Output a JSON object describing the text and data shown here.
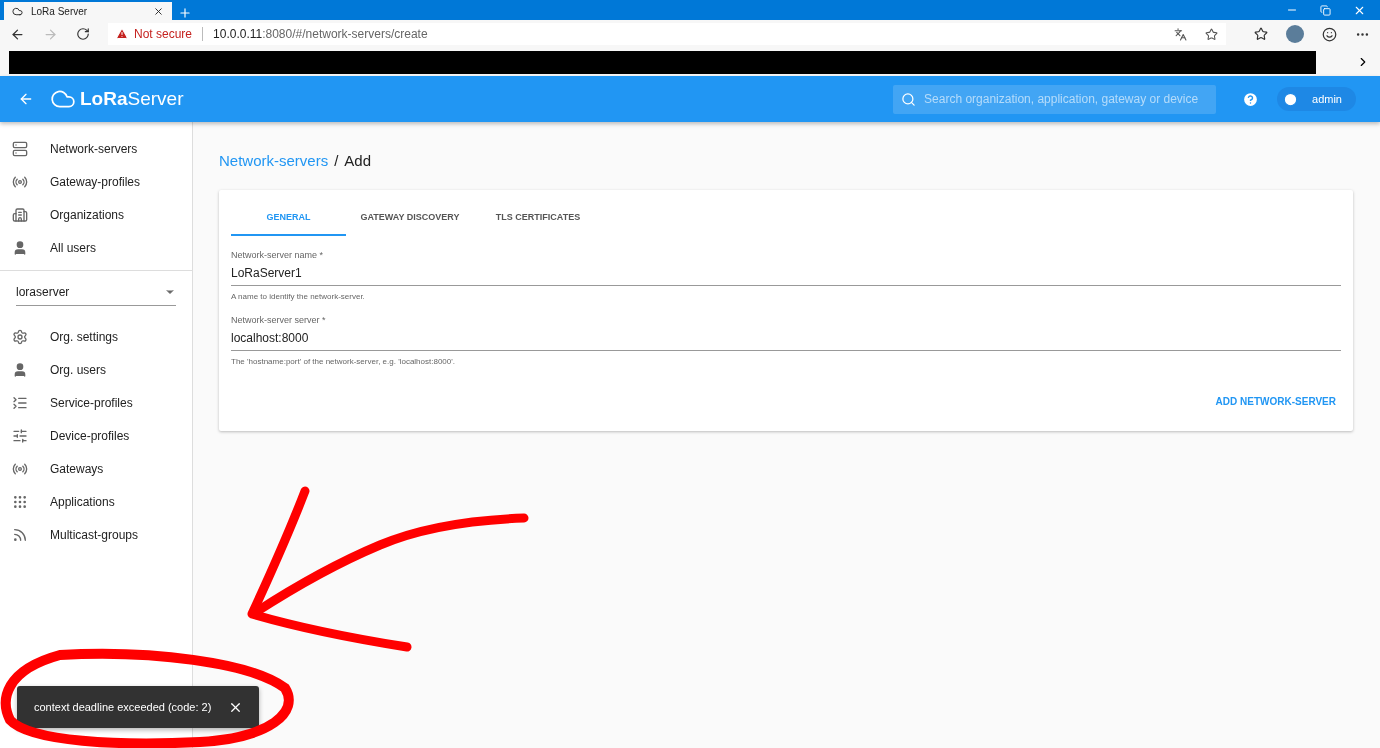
{
  "browser": {
    "tab_title": "LoRa Server",
    "security": "Not secure",
    "host": "10.0.0.11",
    "path": ":8080/#/network-servers/create"
  },
  "app_bar": {
    "brand": "**LoRa**Server",
    "search": {
      "placeholder": "Search organization, application, gateway or device"
    },
    "user": "admin"
  },
  "sidebar": {
    "global_items": [
      {
        "label": "Network-servers"
      },
      {
        "label": "Gateway-profiles"
      },
      {
        "label": "Organizations"
      },
      {
        "label": "All users"
      }
    ],
    "org_select": {
      "value": "loraserver"
    },
    "org_items": [
      {
        "label": "Org. settings"
      },
      {
        "label": "Org. users"
      },
      {
        "label": "Service-profiles"
      },
      {
        "label": "Device-profiles"
      },
      {
        "label": "Gateways"
      },
      {
        "label": "Applications"
      },
      {
        "label": "Multicast-groups"
      }
    ]
  },
  "breadcrumb": {
    "parent": "Network-servers",
    "separator": "/",
    "current": "Add"
  },
  "tabs": [
    {
      "label": "GENERAL",
      "selected": true
    },
    {
      "label": "GATEWAY DISCOVERY",
      "selected": false
    },
    {
      "label": "TLS CERTIFICATES",
      "selected": false
    }
  ],
  "fields": [
    {
      "label": "Network-server name *",
      "value": "LoRaServer1",
      "helper": "A name to identify the network-server."
    },
    {
      "label": "Network-server server *",
      "value": "localhost:8000",
      "helper": "The 'hostname:port' of the network-server, e.g. 'localhost:8000'."
    }
  ],
  "submit": "ADD NETWORK-SERVER",
  "snackbar": {
    "message": "context deadline exceeded (code: 2)"
  }
}
